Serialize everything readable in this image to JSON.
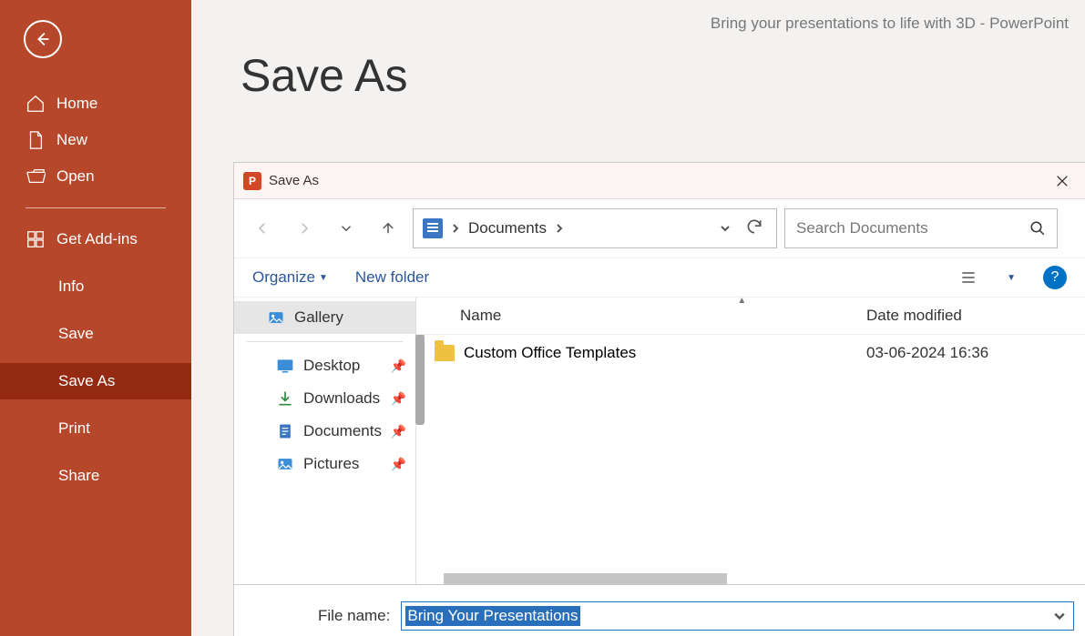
{
  "window_title": "Bring your presentations to life with 3D  -  PowerPoint",
  "page_heading": "Save As",
  "backstage": {
    "home": "Home",
    "new": "New",
    "open": "Open",
    "addins": "Get Add-ins",
    "info": "Info",
    "save": "Save",
    "saveas": "Save As",
    "print": "Print",
    "share": "Share"
  },
  "dialog": {
    "title": "Save As",
    "breadcrumb": "Documents",
    "search_placeholder": "Search Documents",
    "organize": "Organize",
    "new_folder": "New folder",
    "columns": {
      "name": "Name",
      "date": "Date modified"
    },
    "tree": {
      "gallery": "Gallery",
      "desktop": "Desktop",
      "downloads": "Downloads",
      "documents": "Documents",
      "pictures": "Pictures"
    },
    "rows": [
      {
        "name": "Custom Office Templates",
        "date": "03-06-2024 16:36"
      }
    ],
    "filename_label": "File name:",
    "filename_value": "Bring Your Presentations"
  }
}
